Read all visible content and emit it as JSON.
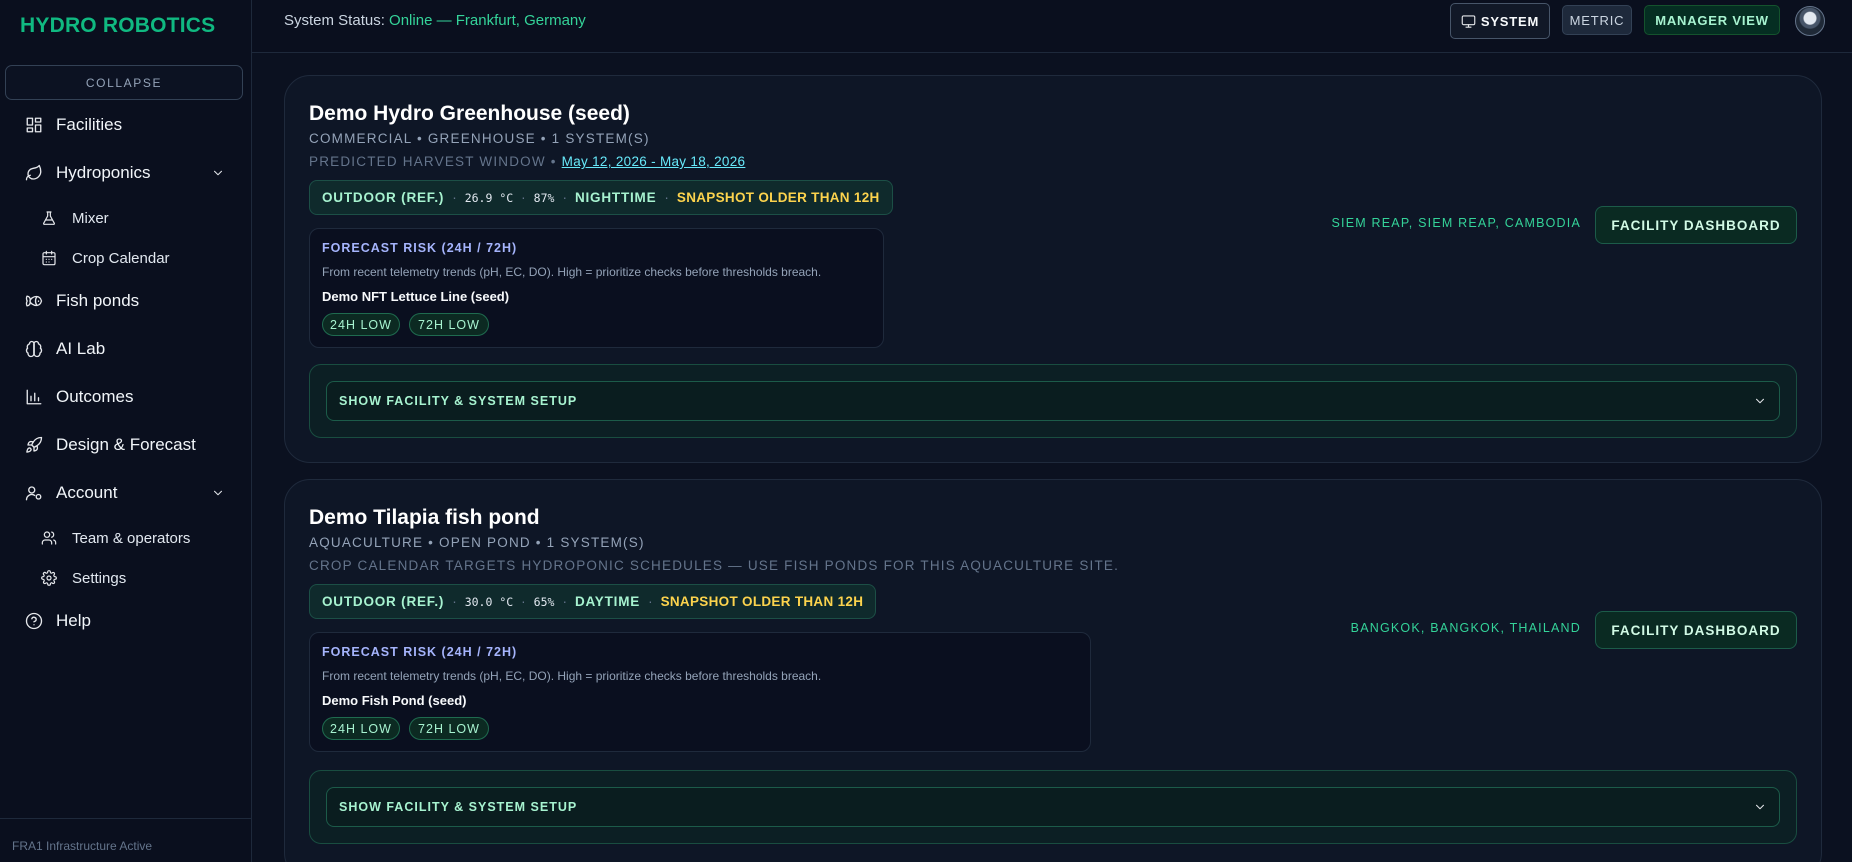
{
  "app": {
    "brand": "HYDRO ROBOTICS"
  },
  "sidebar": {
    "collapse_label": "COLLAPSE",
    "items": [
      {
        "label": "Facilities",
        "icon": "grid-icon"
      },
      {
        "label": "Hydroponics",
        "icon": "leaf-icon"
      },
      {
        "label": "Mixer",
        "icon": "flask-icon"
      },
      {
        "label": "Crop Calendar",
        "icon": "calendar-icon"
      },
      {
        "label": "Fish ponds",
        "icon": "fish-icon"
      },
      {
        "label": "AI Lab",
        "icon": "brain-icon"
      },
      {
        "label": "Outcomes",
        "icon": "bar-chart-icon"
      },
      {
        "label": "Design & Forecast",
        "icon": "rocket-icon"
      },
      {
        "label": "Account",
        "icon": "user-gear-icon"
      },
      {
        "label": "Team & operators",
        "icon": "users-icon"
      },
      {
        "label": "Settings",
        "icon": "gear-icon"
      },
      {
        "label": "Help",
        "icon": "help-circle-icon"
      }
    ],
    "footer": "FRA1 Infrastructure Active"
  },
  "topbar": {
    "status_label": "System Status:",
    "status_value": "Online — Frankfurt, Germany",
    "system_btn": "SYSTEM",
    "metric_btn": "METRIC",
    "manager_btn": "MANAGER VIEW"
  },
  "facilities": [
    {
      "title": "Demo Hydro Greenhouse (seed)",
      "meta": "COMMERCIAL • GREENHOUSE • 1 SYSTEM(S)",
      "note_prefix": "PREDICTED HARVEST WINDOW •",
      "note_link": "May 12, 2026 - May 18, 2026",
      "weather": {
        "label": "OUTDOOR (REF.)",
        "temp": "26.9 °C",
        "humidity": "87%",
        "period": "NIGHTTIME",
        "warning": "SNAPSHOT OLDER THAN 12H"
      },
      "forecast": {
        "title": "FORECAST RISK (24H / 72H)",
        "desc": "From recent telemetry trends (pH, EC, DO). High = prioritize checks before thresholds breach.",
        "system": "Demo NFT Lettuce Line (seed)",
        "risk24": "24H LOW",
        "risk72": "72H LOW"
      },
      "location": "SIEM REAP, SIEM REAP, CAMBODIA",
      "dashboard_btn": "FACILITY DASHBOARD",
      "setup_btn": "SHOW FACILITY & SYSTEM SETUP"
    },
    {
      "title": "Demo Tilapia fish pond",
      "meta": "AQUACULTURE • OPEN POND • 1 SYSTEM(S)",
      "note": "CROP CALENDAR TARGETS HYDROPONIC SCHEDULES — USE FISH PONDS FOR THIS AQUACULTURE SITE.",
      "weather": {
        "label": "OUTDOOR (REF.)",
        "temp": "30.0 °C",
        "humidity": "65%",
        "period": "DAYTIME",
        "warning": "SNAPSHOT OLDER THAN 12H"
      },
      "forecast": {
        "title": "FORECAST RISK (24H / 72H)",
        "desc": "From recent telemetry trends (pH, EC, DO). High = prioritize checks before thresholds breach.",
        "system": "Demo Fish Pond (seed)",
        "risk24": "24H LOW",
        "risk72": "72H LOW"
      },
      "location": "BANGKOK, BANGKOK, THAILAND",
      "dashboard_btn": "FACILITY DASHBOARD",
      "setup_btn": "SHOW FACILITY & SYSTEM SETUP"
    }
  ]
}
